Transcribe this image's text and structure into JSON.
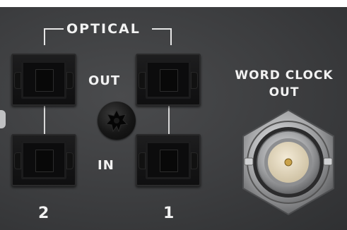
{
  "labels": {
    "optical": "OPTICAL",
    "out": "OUT",
    "in": "IN",
    "port_2": "2",
    "port_1": "1",
    "word_clock_line1": "WORD CLOCK",
    "word_clock_line2": "OUT"
  },
  "colors": {
    "panel": "#3c3d3f",
    "silkscreen": "#f2f2f2",
    "jack_body": "#141415",
    "bnc_metal": "#c9cacc",
    "bnc_gold": "#c9a24a"
  },
  "icons": {
    "optical_jack": "toslink-port",
    "screw": "torx-screw",
    "bnc": "bnc-connector"
  }
}
